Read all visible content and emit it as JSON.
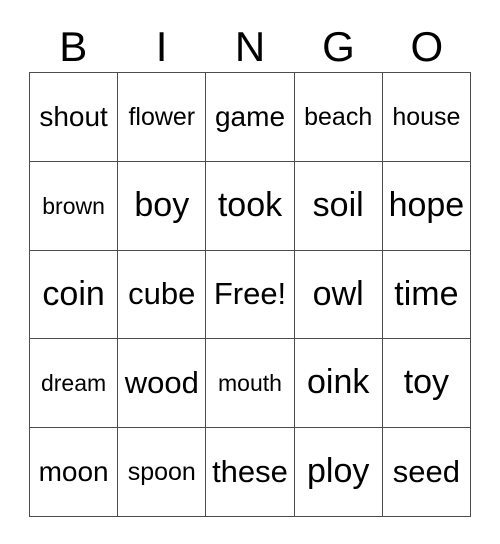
{
  "card": {
    "header": {
      "letters": [
        "B",
        "I",
        "N",
        "G",
        "O"
      ]
    },
    "grid": {
      "columns": 5,
      "rows": 5,
      "free_space": "Free!",
      "free_space_position": {
        "row": 3,
        "column": 3
      },
      "border_color": "#4d4d4d",
      "background_color": "#ffffff",
      "text_color": "#000000",
      "cells": [
        [
          {
            "text": "shout",
            "size": "md"
          },
          {
            "text": "flower",
            "size": "sm"
          },
          {
            "text": "game",
            "size": "md"
          },
          {
            "text": "beach",
            "size": "sm"
          },
          {
            "text": "house",
            "size": "sm"
          }
        ],
        [
          {
            "text": "brown",
            "size": "xs"
          },
          {
            "text": "boy",
            "size": "xl"
          },
          {
            "text": "took",
            "size": "xl"
          },
          {
            "text": "soil",
            "size": "xl"
          },
          {
            "text": "hope",
            "size": "xl"
          }
        ],
        [
          {
            "text": "coin",
            "size": "xl"
          },
          {
            "text": "cube",
            "size": "lg"
          },
          {
            "text": "Free!",
            "size": "lg"
          },
          {
            "text": "owl",
            "size": "xl"
          },
          {
            "text": "time",
            "size": "xl"
          }
        ],
        [
          {
            "text": "dream",
            "size": "xs"
          },
          {
            "text": "wood",
            "size": "lg"
          },
          {
            "text": "mouth",
            "size": "xs"
          },
          {
            "text": "oink",
            "size": "xl"
          },
          {
            "text": "toy",
            "size": "xl"
          }
        ],
        [
          {
            "text": "moon",
            "size": "md"
          },
          {
            "text": "spoon",
            "size": "sm"
          },
          {
            "text": "these",
            "size": "lg"
          },
          {
            "text": "ploy",
            "size": "xl"
          },
          {
            "text": "seed",
            "size": "lg"
          }
        ]
      ]
    }
  }
}
